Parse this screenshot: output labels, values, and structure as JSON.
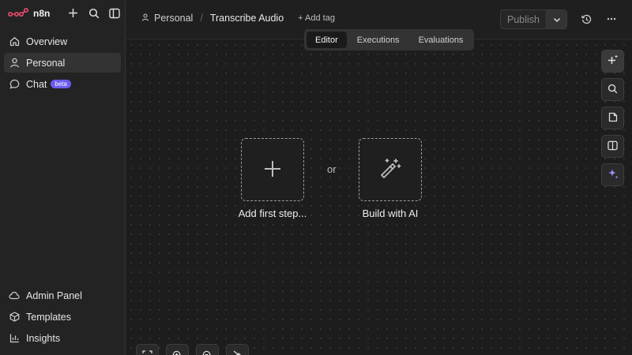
{
  "app": {
    "brand": "n8n"
  },
  "sidebar": {
    "top_items": [
      {
        "label": "Overview",
        "icon": "home-icon"
      },
      {
        "label": "Personal",
        "icon": "user-icon",
        "active": true
      },
      {
        "label": "Chat",
        "icon": "chat-icon",
        "badge": "beta"
      }
    ],
    "bottom_items": [
      {
        "label": "Admin Panel",
        "icon": "cloud-icon"
      },
      {
        "label": "Templates",
        "icon": "box-icon"
      },
      {
        "label": "Insights",
        "icon": "bar-chart-icon"
      }
    ]
  },
  "header": {
    "project": "Personal",
    "workflow_title": "Transcribe Audio",
    "add_tag": "+ Add tag",
    "publish_label": "Publish"
  },
  "tabs": [
    {
      "label": "Editor",
      "active": true
    },
    {
      "label": "Executions"
    },
    {
      "label": "Evaluations"
    }
  ],
  "canvas": {
    "add_first_step": "Add first step...",
    "or": "or",
    "build_with_ai": "Build with AI"
  },
  "colors": {
    "accent": "#6b5cf0",
    "ai_sparkle": "#a78bfa",
    "brand_logo": "#ea4b71"
  }
}
